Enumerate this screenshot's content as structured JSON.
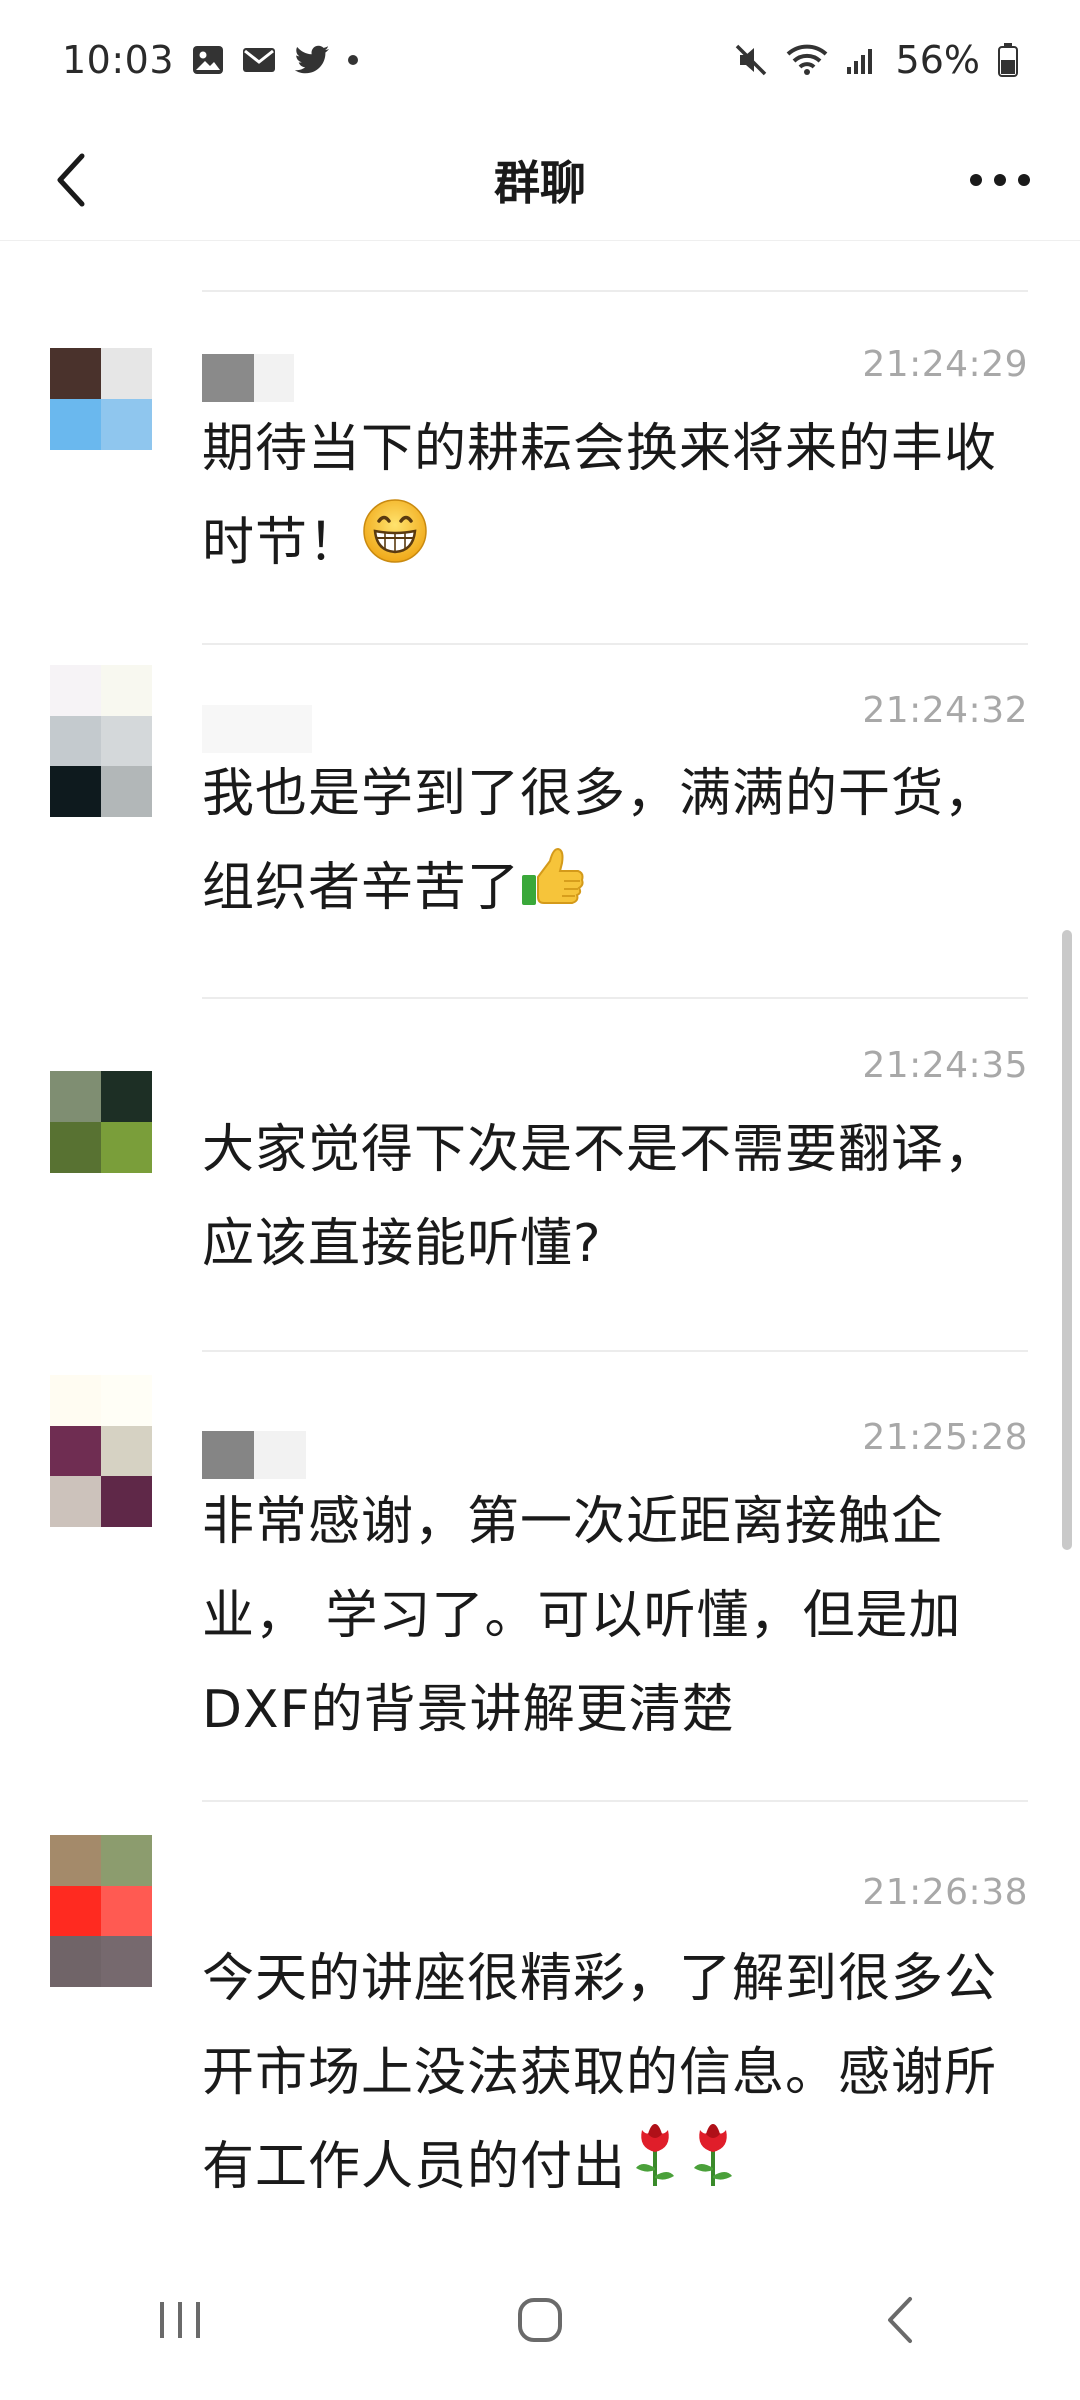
{
  "status_bar": {
    "time": "10:03",
    "battery_text": "56%",
    "left_icons": [
      "gallery-icon",
      "mail-icon",
      "twitter-icon",
      "dot-icon"
    ],
    "right_icons": [
      "mute-icon",
      "wifi-icon",
      "signal-icon",
      "battery-icon"
    ]
  },
  "header": {
    "title": "群聊",
    "back_icon": "back-chevron-icon",
    "more_icon": "more-dots-icon"
  },
  "messages": [
    {
      "time": "21:24:29",
      "text": "期待当下的耕耘会换来将来的丰收时节！",
      "emoji": "grinning-face-icon"
    },
    {
      "time": "21:24:32",
      "text": "我也是学到了很多，满满的干货，组织者辛苦了",
      "emoji": "thumbs-up-icon"
    },
    {
      "time": "21:24:35",
      "text": "大家觉得下次是不是不需要翻译，应该直接能听懂?"
    },
    {
      "time": "21:25:28",
      "text": "非常感谢，第一次近距离接触企业， 学习了。可以听懂，但是加DXF的背景讲解更清楚"
    },
    {
      "time": "21:26:38",
      "text": "今天的讲座很精彩，了解到很多公开市场上没法获取的信息。感谢所有工作人员的付出",
      "emoji": "rose-icon"
    }
  ],
  "nav_bar": {
    "icons": [
      "recent-apps-icon",
      "home-icon",
      "back-nav-icon"
    ]
  },
  "colors": {
    "text": "#1a1a1a",
    "timestamp": "#a8a8a8",
    "divider": "#ececec",
    "background": "#ffffff"
  }
}
